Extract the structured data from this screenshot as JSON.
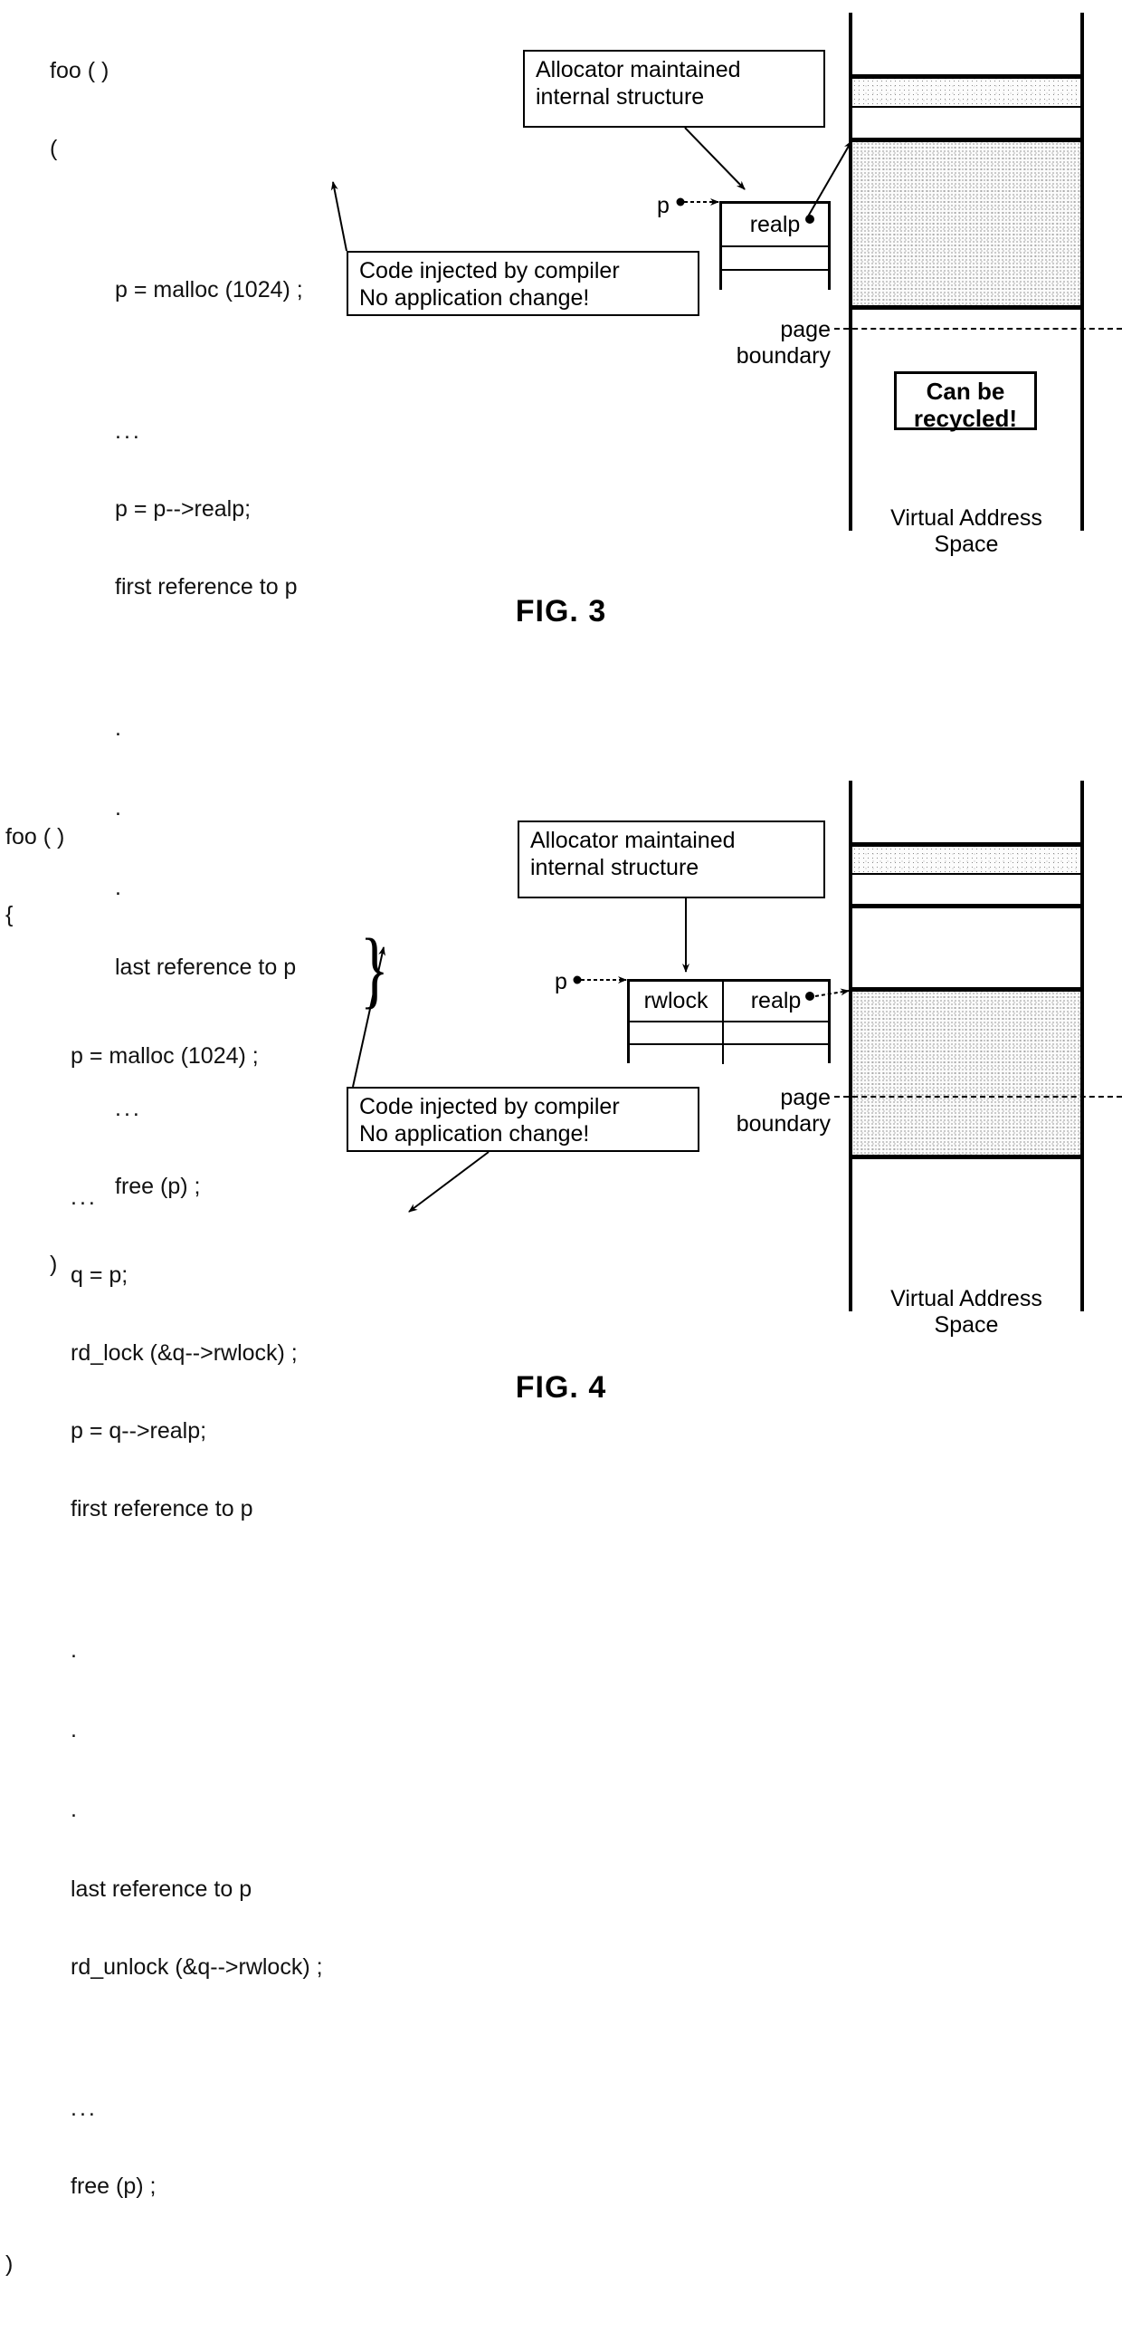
{
  "figures": [
    {
      "id": "fig3",
      "label": "FIG. 3",
      "code": {
        "lines": [
          "foo ( )",
          "(",
          "p = malloc (1024) ;",
          "...",
          "p = p-->realp;",
          "first reference to p",
          ".",
          ".",
          ".",
          "last reference to p",
          "...",
          "free (p) ;",
          ")"
        ]
      },
      "callouts": {
        "allocator": "Allocator maintained\ninternal structure",
        "injected": "Code injected by compiler\nNo application change!"
      },
      "struct": {
        "pointer_label": "p",
        "rows": [
          [
            "realp"
          ],
          [
            ""
          ],
          [
            ""
          ]
        ]
      },
      "memory": {
        "page_boundary_label": "page\nboundary",
        "recycle_label": "Can be\nrecycled!",
        "vas_label": "Virtual Address\nSpace"
      }
    },
    {
      "id": "fig4",
      "label": "FIG. 4",
      "code": {
        "lines": [
          "foo ( )",
          "{",
          "p = malloc (1024) ;",
          "...",
          "q = p;",
          "rd_lock (&q-->rwlock) ;",
          "p = q-->realp;",
          "first reference to p",
          ".",
          ".",
          ".",
          "last reference to p",
          "rd_unlock (&q-->rwlock) ;",
          "...",
          "free (p) ;",
          ")"
        ]
      },
      "callouts": {
        "allocator": "Allocator maintained\ninternal structure",
        "injected": "Code injected by compiler\nNo application change!"
      },
      "struct": {
        "pointer_label": "p",
        "rows": [
          [
            "rwlock",
            "realp"
          ],
          [
            "",
            ""
          ],
          [
            "",
            ""
          ]
        ]
      },
      "memory": {
        "page_boundary_label": "page\nboundary",
        "vas_label": "Virtual Address\nSpace"
      }
    }
  ],
  "colors": {
    "ink": "#000000",
    "paper": "#ffffff",
    "shade": "#d8d8d8"
  }
}
